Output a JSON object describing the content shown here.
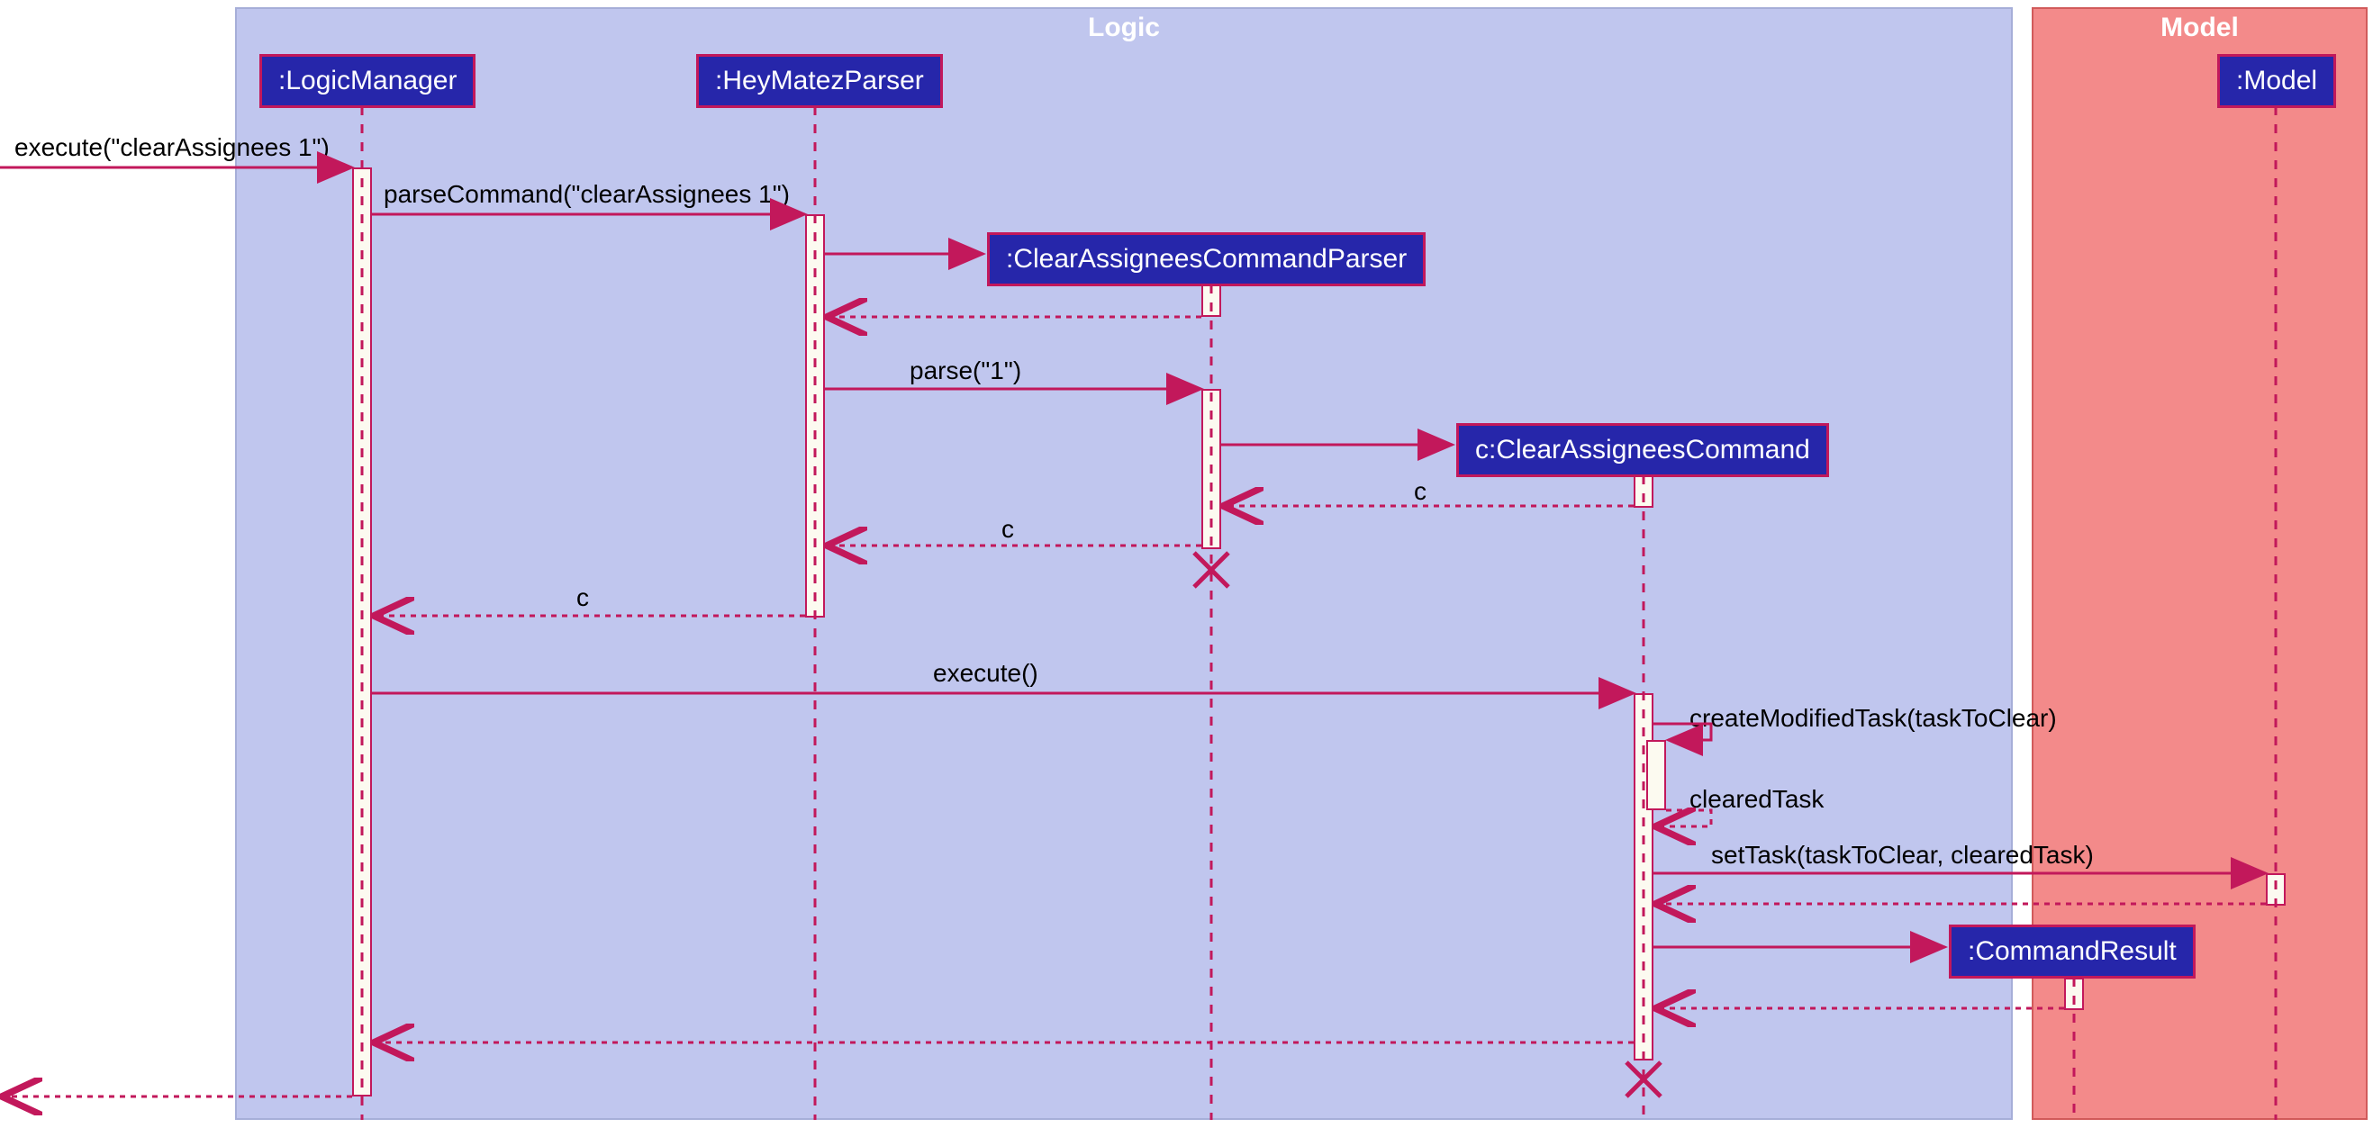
{
  "frames": {
    "logic": "Logic",
    "model": "Model"
  },
  "participants": {
    "logic_manager": ":LogicManager",
    "heymatez_parser": ":HeyMatezParser",
    "clear_assignees_parser": ":ClearAssigneesCommandParser",
    "clear_assignees_command": "c:ClearAssigneesCommand",
    "model": ":Model",
    "command_result": ":CommandResult"
  },
  "messages": {
    "m1": "execute(\"clearAssignees 1\")",
    "m2": "parseCommand(\"clearAssignees 1\")",
    "m3": "parse(\"1\")",
    "m4": "c",
    "m5": "c",
    "m6": "c",
    "m7": "execute()",
    "m8": "createModifiedTask(taskToClear)",
    "m9": "clearedTask",
    "m10": "setTask(taskToClear, clearedTask)"
  },
  "colors": {
    "arrow": "#c2185b",
    "lifeline": "#c2185b"
  }
}
